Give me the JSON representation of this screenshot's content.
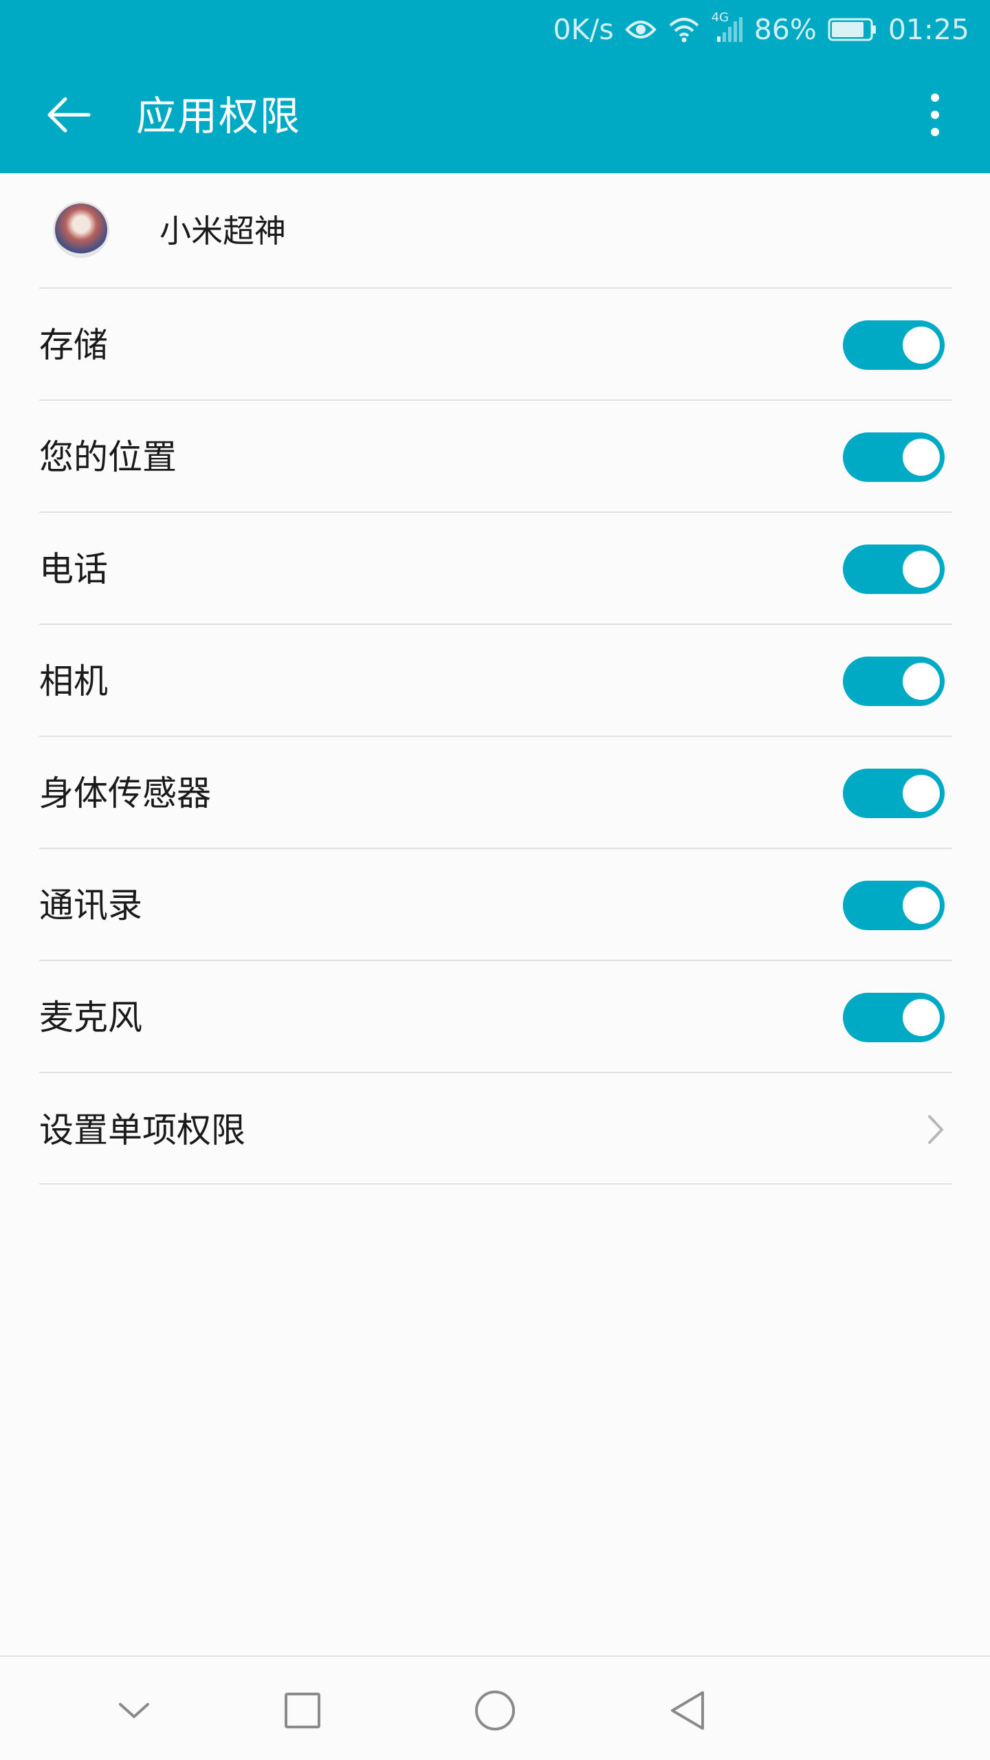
{
  "status_bar": {
    "net_speed": "0K/s",
    "network_type": "4G",
    "battery_percent": "86%",
    "battery_level": 0.86,
    "time": "01:25",
    "icons": [
      "eye-icon",
      "wifi-icon",
      "signal-4g-icon",
      "battery-icon"
    ]
  },
  "app_bar": {
    "title": "应用权限",
    "back_icon": "arrow-left-icon",
    "more_icon": "more-vertical-icon",
    "color": "#00a9c4"
  },
  "app_info": {
    "name": "小米超神",
    "icon": "app-avatar"
  },
  "permissions": [
    {
      "label": "存储",
      "enabled": true
    },
    {
      "label": "您的位置",
      "enabled": true
    },
    {
      "label": "电话",
      "enabled": true
    },
    {
      "label": "相机",
      "enabled": true
    },
    {
      "label": "身体传感器",
      "enabled": true
    },
    {
      "label": "通讯录",
      "enabled": true
    },
    {
      "label": "麦克风",
      "enabled": true
    }
  ],
  "individual_settings": {
    "label": "设置单项权限",
    "icon": "chevron-right-icon"
  },
  "nav_bar": {
    "buttons": [
      "chevron-down-icon",
      "square-icon",
      "circle-icon",
      "triangle-back-icon"
    ]
  }
}
